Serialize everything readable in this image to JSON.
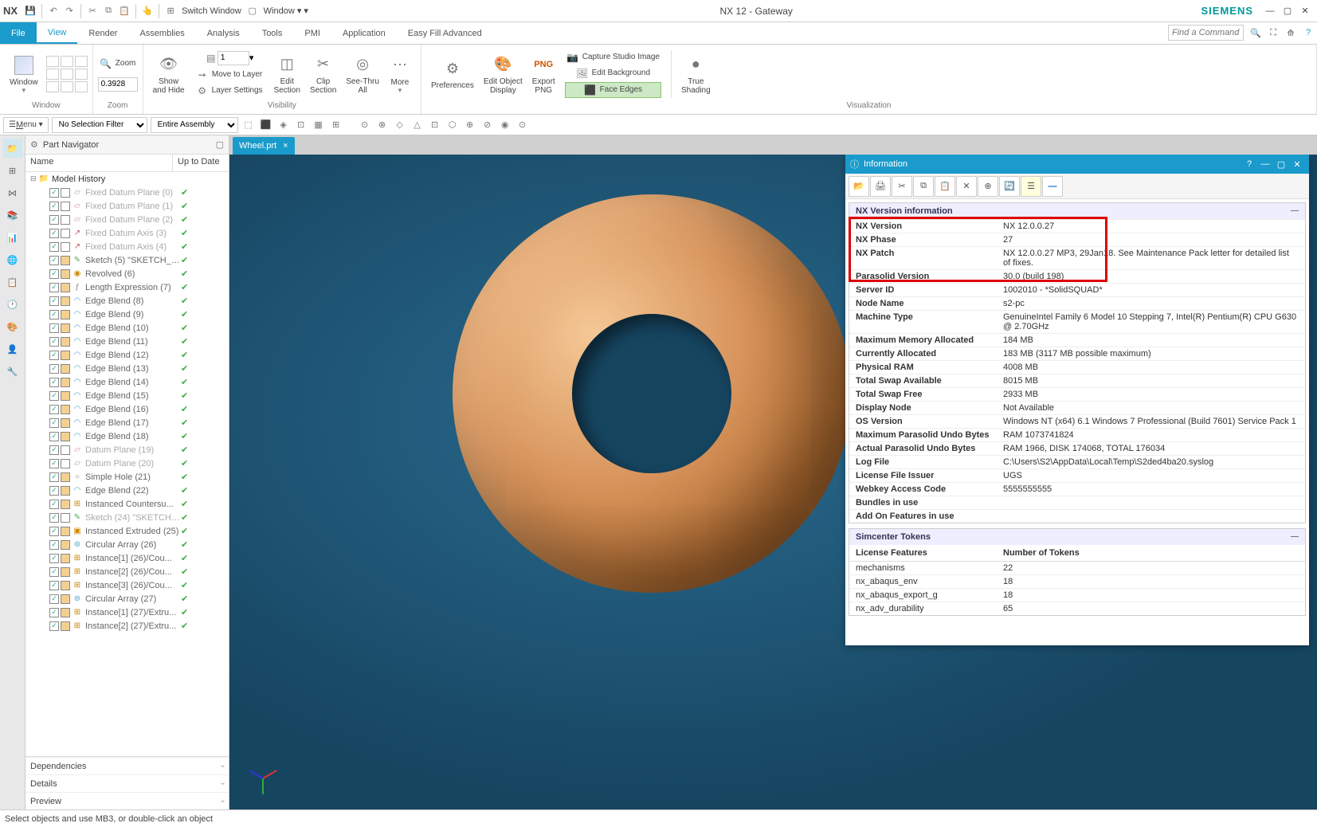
{
  "titlebar": {
    "app": "NX",
    "switch_window": "Switch Window",
    "window_menu": "Window",
    "title": "NX 12 - Gateway",
    "brand": "SIEMENS"
  },
  "menubar": {
    "tabs": [
      "File",
      "View",
      "Render",
      "Assemblies",
      "Analysis",
      "Tools",
      "PMI",
      "Application",
      "Easy Fill Advanced"
    ],
    "search_placeholder": "Find a Command"
  },
  "ribbon": {
    "window": {
      "label": "Window",
      "btn": "Window"
    },
    "zoom": {
      "label": "Zoom",
      "zoom_label": "Zoom",
      "value": "0.3928"
    },
    "visibility": {
      "label": "Visibility",
      "show_hide": "Show\nand Hide",
      "layer_dropdown": "1",
      "move_to_layer": "Move to Layer",
      "layer_settings": "Layer Settings",
      "edit_section": "Edit\nSection",
      "clip_section": "Clip\nSection",
      "see_thru": "See-Thru\nAll",
      "more": "More"
    },
    "visualization": {
      "label": "Visualization",
      "preferences": "Preferences",
      "edit_obj": "Edit Object\nDisplay",
      "export_png": "Export\nPNG",
      "png_label": "PNG",
      "capture": "Capture Studio Image",
      "edit_bg": "Edit Background",
      "face_edges": "Face Edges",
      "true_shading": "True\nShading"
    }
  },
  "toolbar2": {
    "menu": "Menu",
    "filter1": "No Selection Filter",
    "filter2": "Entire Assembly"
  },
  "navigator": {
    "title": "Part Navigator",
    "col_name": "Name",
    "col_uptodate": "Up to Date",
    "root": "Model History",
    "items": [
      {
        "label": "Fixed Datum Plane (0)",
        "icon": "plane",
        "dim": true
      },
      {
        "label": "Fixed Datum Plane (1)",
        "icon": "plane",
        "dim": true
      },
      {
        "label": "Fixed Datum Plane (2)",
        "icon": "plane",
        "dim": true
      },
      {
        "label": "Fixed Datum Axis (3)",
        "icon": "axis",
        "dim": true
      },
      {
        "label": "Fixed Datum Axis (4)",
        "icon": "axis",
        "dim": true
      },
      {
        "label": "Sketch (5) \"SKETCH_0...",
        "icon": "sketch"
      },
      {
        "label": "Revolved (6)",
        "icon": "revolve"
      },
      {
        "label": "Length Expression (7)",
        "icon": "expr"
      },
      {
        "label": "Edge Blend (8)",
        "icon": "blend"
      },
      {
        "label": "Edge Blend (9)",
        "icon": "blend"
      },
      {
        "label": "Edge Blend (10)",
        "icon": "blend"
      },
      {
        "label": "Edge Blend (11)",
        "icon": "blend"
      },
      {
        "label": "Edge Blend (12)",
        "icon": "blend"
      },
      {
        "label": "Edge Blend (13)",
        "icon": "blend"
      },
      {
        "label": "Edge Blend (14)",
        "icon": "blend"
      },
      {
        "label": "Edge Blend (15)",
        "icon": "blend"
      },
      {
        "label": "Edge Blend (16)",
        "icon": "blend"
      },
      {
        "label": "Edge Blend (17)",
        "icon": "blend"
      },
      {
        "label": "Edge Blend (18)",
        "icon": "blend"
      },
      {
        "label": "Datum Plane (19)",
        "icon": "plane",
        "dim": true
      },
      {
        "label": "Datum Plane (20)",
        "icon": "plane",
        "dim": true
      },
      {
        "label": "Simple Hole (21)",
        "icon": "hole"
      },
      {
        "label": "Edge Blend (22)",
        "icon": "blend"
      },
      {
        "label": "Instanced Countersu...",
        "icon": "instance"
      },
      {
        "label": "Sketch (24) \"SKETCH_...",
        "icon": "sketch",
        "dim": true
      },
      {
        "label": "Instanced Extruded (25)",
        "icon": "extrude"
      },
      {
        "label": "Circular Array (26)",
        "icon": "array"
      },
      {
        "label": "Instance[1] (26)/Cou...",
        "icon": "instance"
      },
      {
        "label": "Instance[2] (26)/Cou...",
        "icon": "instance"
      },
      {
        "label": "Instance[3] (26)/Cou...",
        "icon": "instance"
      },
      {
        "label": "Circular Array (27)",
        "icon": "array"
      },
      {
        "label": "Instance[1] (27)/Extru...",
        "icon": "instance"
      },
      {
        "label": "Instance[2] (27)/Extru...",
        "icon": "instance"
      }
    ],
    "bottom": [
      "Dependencies",
      "Details",
      "Preview"
    ]
  },
  "file_tab": "Wheel.prt",
  "info_panel": {
    "title": "Information",
    "section1": "NX Version information",
    "rows": [
      {
        "k": "NX Version",
        "v": "NX 12.0.0.27",
        "hl": true
      },
      {
        "k": "NX Phase",
        "v": "27",
        "hl": true
      },
      {
        "k": "NX Patch",
        "v": "NX 12.0.0.27 MP3, 29Jan18. See Maintenance Pack letter for detailed list of fixes.",
        "hl": true
      },
      {
        "k": "Parasolid Version",
        "v": "30.0 (build 198)",
        "hl": true
      },
      {
        "k": "Server ID",
        "v": "1002010 - *SolidSQUAD*"
      },
      {
        "k": "Node Name",
        "v": "s2-pc"
      },
      {
        "k": "Machine Type",
        "v": "GenuineIntel Family 6 Model 10 Stepping 7, Intel(R) Pentium(R) CPU G630 @ 2.70GHz"
      },
      {
        "k": "Maximum Memory Allocated",
        "v": "184 MB"
      },
      {
        "k": "Currently Allocated",
        "v": "183 MB (3117 MB possible maximum)"
      },
      {
        "k": "Physical RAM",
        "v": "4008 MB"
      },
      {
        "k": "Total Swap Available",
        "v": "8015 MB"
      },
      {
        "k": "Total Swap Free",
        "v": "2933 MB"
      },
      {
        "k": "Display Node",
        "v": "Not Available"
      },
      {
        "k": "OS Version",
        "v": "Windows NT (x64) 6.1 Windows 7 Professional (Build 7601) Service Pack 1"
      },
      {
        "k": "Maximum Parasolid Undo Bytes",
        "v": "RAM 1073741824"
      },
      {
        "k": "Actual Parasolid Undo Bytes",
        "v": "RAM 1966, DISK 174068, TOTAL 176034"
      },
      {
        "k": "Log File",
        "v": "C:\\Users\\S2\\AppData\\Local\\Temp\\S2ded4ba20.syslog"
      },
      {
        "k": "License File Issuer",
        "v": "UGS"
      },
      {
        "k": "Webkey Access Code",
        "v": "5555555555"
      },
      {
        "k": "Bundles in use",
        "v": ""
      },
      {
        "k": "Add On Features in use",
        "v": ""
      }
    ],
    "section2": "Simcenter Tokens",
    "token_cols": [
      "License Features",
      "Number of Tokens"
    ],
    "tokens": [
      {
        "k": "mechanisms",
        "v": "22"
      },
      {
        "k": "nx_abaqus_env",
        "v": "18"
      },
      {
        "k": "nx_abaqus_export_g",
        "v": "18"
      },
      {
        "k": "nx_adv_durability",
        "v": "65"
      }
    ]
  },
  "statusbar": "Select objects and use MB3, or double-click an object"
}
